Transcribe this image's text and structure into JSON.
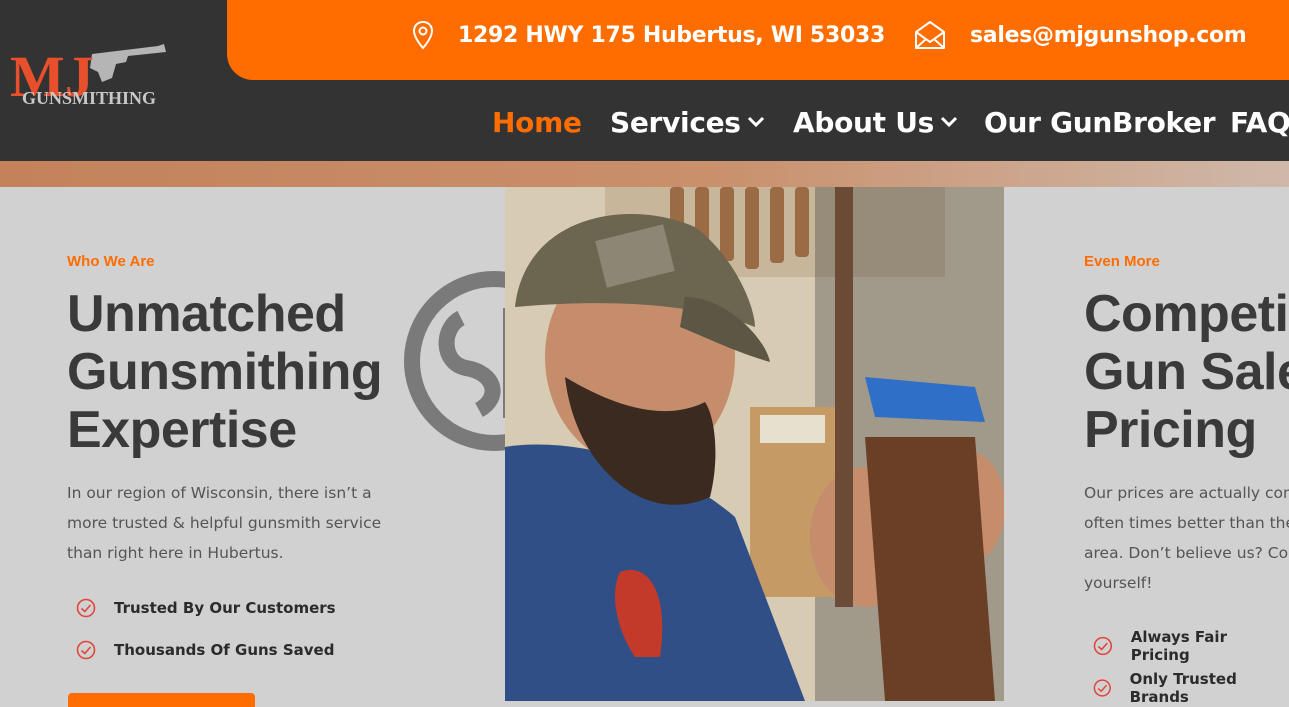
{
  "logo": {
    "text_top": "MJ",
    "text_bottom": "GUNSMITHING"
  },
  "contact": {
    "address": "1292 HWY 175 Hubertus, WI 53033",
    "email": "sales@mjgunshop.com"
  },
  "nav": {
    "items": [
      {
        "label": "Home",
        "active": true
      },
      {
        "label": "Services",
        "dropdown": true
      },
      {
        "label": "About Us",
        "dropdown": true
      },
      {
        "label": "Our GunBroker"
      },
      {
        "label": "FAQ"
      }
    ]
  },
  "left": {
    "eyebrow": "Who We Are",
    "headline": [
      "Unmatched",
      "Gunsmithing",
      "Expertise"
    ],
    "paragraph": [
      "In our region of Wisconsin, there isn’t a",
      "more trusted & helpful gunsmith service",
      "than right here in Hubertus."
    ],
    "checks": [
      "Trusted By Our Customers",
      "Thousands Of Guns Saved"
    ]
  },
  "right": {
    "eyebrow": "Even More",
    "headline": [
      "Competi",
      "Gun Sale",
      "Pricing"
    ],
    "paragraph": [
      "Our prices are actually comp",
      "often times better than the",
      "area. Don’t believe us? Com",
      "yourself!"
    ],
    "checks": [
      "Always Fair Pricing",
      "Only Trusted Brands"
    ]
  },
  "colors": {
    "accent": "#ff6c00",
    "dark": "#333333",
    "background": "#d1d1d1"
  },
  "icons": {
    "address": "map-pin-icon",
    "email": "envelope-icon",
    "check": "check-circle-icon",
    "dropdown": "chevron-down-icon"
  }
}
